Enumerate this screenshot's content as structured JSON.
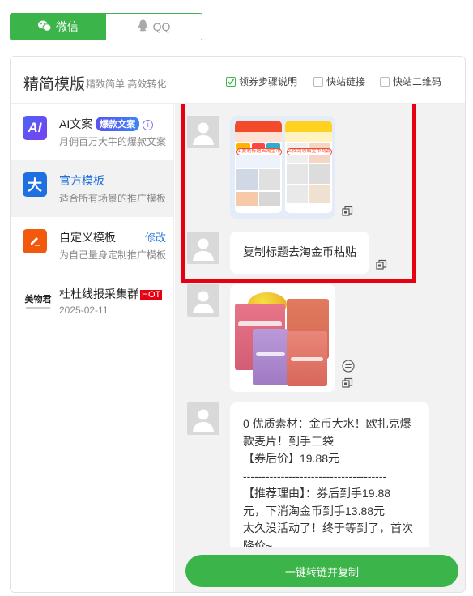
{
  "tabs": [
    {
      "label": "微信",
      "icon": "wechat-icon",
      "active": true
    },
    {
      "label": "QQ",
      "icon": "qq-penguin-icon",
      "active": false
    }
  ],
  "header": {
    "title": "精简模版",
    "subtitle": "精致简单 高效转化",
    "options": [
      {
        "label": "领券步骤说明",
        "checked": true
      },
      {
        "label": "快站链接",
        "checked": false
      },
      {
        "label": "快站二维码",
        "checked": false
      }
    ]
  },
  "sidebar": {
    "items": [
      {
        "title": "AI文案",
        "badge": "爆款文案",
        "desc": "月佣百万大牛的爆款文案",
        "icon_text": "AI"
      },
      {
        "title": "官方模板",
        "desc": "适合所有场景的推广模板",
        "icon_text": "大"
      },
      {
        "title": "自定义模板",
        "desc": "为自己量身定制推广模板",
        "action": "修改"
      },
      {
        "title": "杜杜线报采集群",
        "badge": "HOT",
        "desc": "2025-02-11",
        "logo_text": "美物君"
      }
    ]
  },
  "chat": {
    "messages": [
      {
        "type": "image",
        "caption_top": "1.复制标题去淘金币",
        "caption_bottom": "2.找到领取金币商品"
      },
      {
        "type": "text",
        "text": "复制标题去淘金币粘贴"
      },
      {
        "type": "image",
        "product": "Quaker oatmeal bags"
      },
      {
        "type": "text",
        "text": "0 优质素材：金币大水！欧扎克爆\n款麦片！到手三袋\n【券后价】19.88元\n--------------------------------------\n【推荐理由】：券后到手19.88\n元，下消淘金币到手13.88元\n太久没活动了！终于等到了，首次\n降价~"
      }
    ]
  },
  "cta": {
    "label": "一键转链并复制"
  },
  "colors": {
    "brand_green": "#3bb54a",
    "highlight_red": "#e60012",
    "link_blue": "#2e7de0"
  }
}
